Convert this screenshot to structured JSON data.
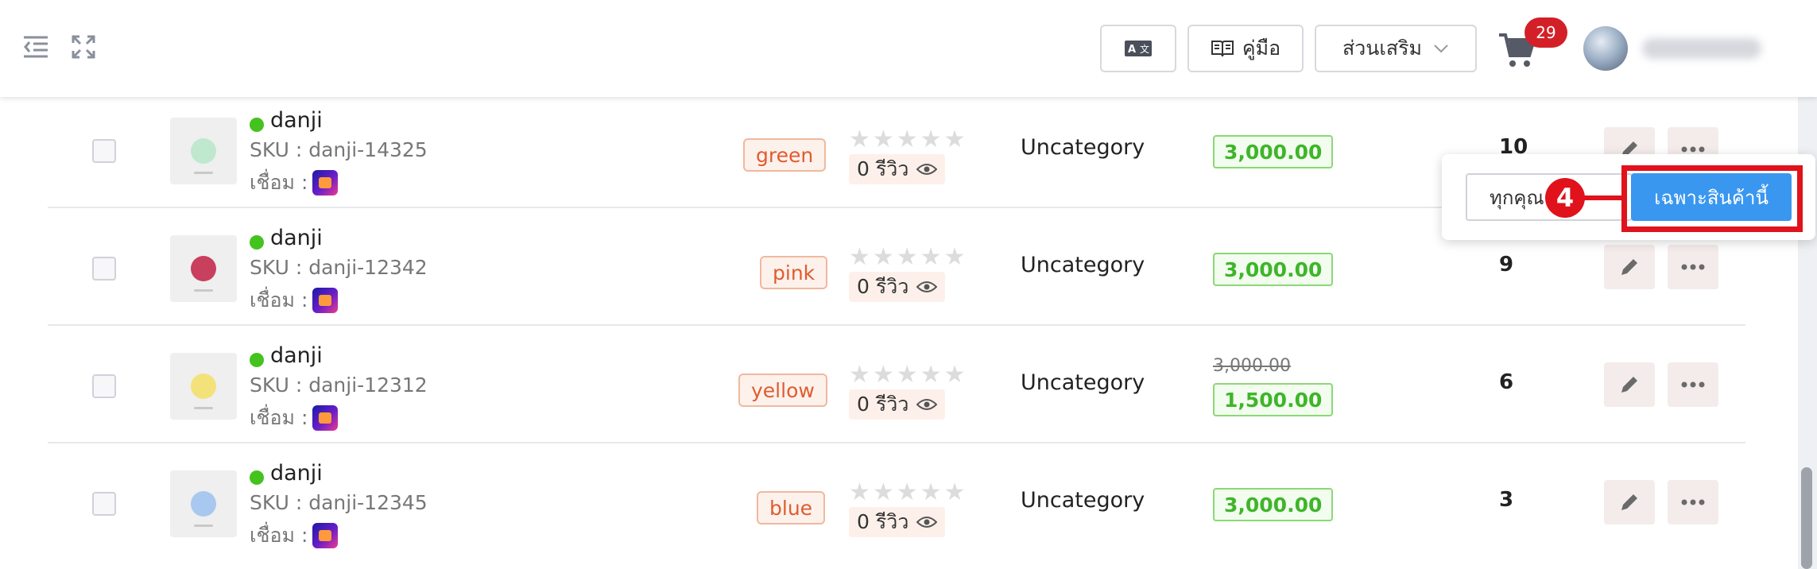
{
  "header": {
    "translate_label": "A文",
    "manual_label": "คู่มือ",
    "addons_label": "ส่วนเสริม",
    "cart_count": "29"
  },
  "products": [
    {
      "name": "danji",
      "sku": "danji-14325",
      "color_tag": "green",
      "reviews": "0 รีวิว",
      "category": "Uncategory",
      "price": "3,000.00",
      "old_price": null,
      "qty": "10",
      "plush_color": "#bfe8cf",
      "rating": 0
    },
    {
      "name": "danji",
      "sku": "danji-12342",
      "color_tag": "pink",
      "reviews": "0 รีวิว",
      "category": "Uncategory",
      "price": "3,000.00",
      "old_price": null,
      "qty": "9",
      "plush_color": "#c8405e",
      "rating": 0
    },
    {
      "name": "danji",
      "sku": "danji-12312",
      "color_tag": "yellow",
      "reviews": "0 รีวิว",
      "category": "Uncategory",
      "price": "1,500.00",
      "old_price": "3,000.00",
      "qty": "6",
      "plush_color": "#f3e27a",
      "rating": 0
    },
    {
      "name": "danji",
      "sku": "danji-12345",
      "color_tag": "blue",
      "reviews": "0 รีวิว",
      "category": "Uncategory",
      "price": "3,000.00",
      "old_price": null,
      "qty": "3",
      "plush_color": "#a9c8ef",
      "rating": 0
    }
  ],
  "labels": {
    "sku_prefix": "SKU : ",
    "link_prefix": "เชื่อม :"
  },
  "popover": {
    "all_label": "ทุกคุณ",
    "this_product_label": "เฉพาะสินค้านี้",
    "callout_number": "4"
  },
  "colors": {
    "accent_blue": "#3a97f0",
    "callout_red": "#e0121b",
    "price_green": "#3fb52a",
    "tag_orange": "#e05c2e"
  }
}
